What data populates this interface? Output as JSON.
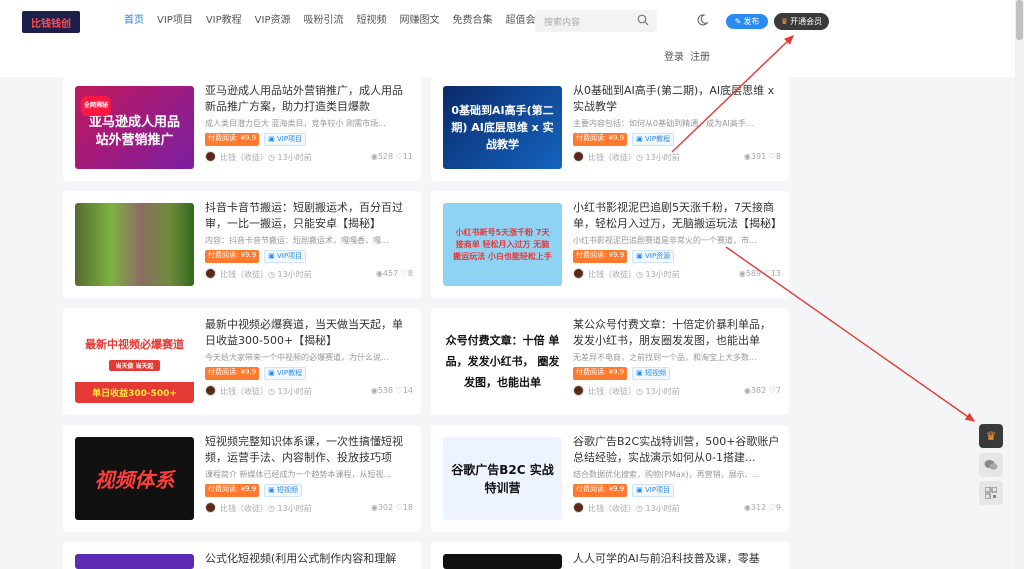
{
  "header": {
    "logo_text": "比钱钱创",
    "nav": [
      "首页",
      "VIP项目",
      "VIP教程",
      "VIP资源",
      "吸粉引流",
      "短视频",
      "网赚图文",
      "免费合集",
      "超值会员"
    ],
    "search_placeholder": "搜索内容",
    "publish_label": "发布",
    "vip_label": "开通会员",
    "login": "登录",
    "register": "注册"
  },
  "posts": [
    {
      "title": "亚马逊成人用品站外营销推广，成人用品新品推广方案，助力打造类目爆款",
      "desc": "成人类目潜力巨大 蓝海类目，竞争较小 刚需市场...",
      "price": "付费阅读: ¥9.9",
      "category": "VIP项目",
      "author": "比钱（收徒）",
      "time": "13小时前",
      "views": "528",
      "likes": "11",
      "thumb_badge": "全网揭秘",
      "thumb_text": "亚马逊成人用品站外营销推广"
    },
    {
      "title": "从0基础到AI高手(第二期)，AI底层思维 x 实战教学",
      "desc": "主要内容包括：如何从0基础到精通，成为AI高手...",
      "price": "付费阅读: ¥9.9",
      "category": "VIP教程",
      "author": "比钱（收徒）",
      "time": "13小时前",
      "views": "391",
      "likes": "8",
      "thumb_text": "0基础到AI高手(第二期) AI底层思维 x 实战教学"
    },
    {
      "title": "抖音卡音节搬运：短剧搬运术，百分百过审，一比一搬运，只能安卓【揭秘】",
      "desc": "内容：抖音卡音节搬运：短剧搬运术，嘎嘎香，嘎...",
      "price": "付费阅读: ¥9.9",
      "category": "VIP项目",
      "author": "比钱（收徒）",
      "time": "13小时前",
      "views": "457",
      "likes": "8",
      "thumb_text": ""
    },
    {
      "title": "小红书影视泥巴追剧5天涨千粉，7天接商单，轻松月入过万，无脑搬运玩法【揭秘】",
      "desc": "小红书影视泥巴追剧赛道是非常火的一个赛道，市...",
      "price": "付费阅读: ¥9.9",
      "category": "VIP资源",
      "author": "比钱（收徒）",
      "time": "13小时前",
      "views": "589",
      "likes": "13",
      "thumb_text": "小红书新号5天涨千粉 7天接商单 轻松月入过万 无脑搬运玩法 小白也能轻松上手"
    },
    {
      "title": "最新中视频必爆赛道，当天做当天起，单日收益300-500+【揭秘】",
      "desc": "今天给大家带来一个中视频的必爆赛道，为什么说...",
      "price": "付费阅读: ¥9.9",
      "category": "VIP教程",
      "author": "比钱（收徒）",
      "time": "13小时前",
      "views": "538",
      "likes": "14",
      "thumb_text": "最新中视频必爆赛道",
      "thumb_sub": "当天做 当天起",
      "thumb_foot": "单日收益300-500+"
    },
    {
      "title": "某公众号付费文章：十倍定价暴利单品，发发小红书，朋友圈发发图，也能出单",
      "desc": "无差异不电商，之前找到一个品，和淘宝上大多数...",
      "price": "付费阅读: ¥9.9",
      "category": "短视频",
      "author": "比钱（收徒）",
      "time": "13小时前",
      "views": "382",
      "likes": "7",
      "thumb_text": "众号付费文章：十倍 单品，发发小红书， 圈发发图，也能出单"
    },
    {
      "title": "短视频完整知识体系课，一次性搞懂短视频，运营手法、内容制作、投放技巧项目...",
      "desc": "课程简介 新媒体已经成为一个趋势本课程，从短视...",
      "price": "付费阅读: ¥9.9",
      "category": "短视频",
      "author": "比钱（收徒）",
      "time": "13小时前",
      "views": "302",
      "likes": "18",
      "thumb_text": "视频体系"
    },
    {
      "title": "谷歌广告B2C实战特训营，500+谷歌账户总结经验，实战演示如何从0-1搭建...",
      "desc": "结合数据优化搜索，购物(PMax)，再营销，展示、...",
      "price": "付费阅读: ¥9.9",
      "category": "VIP项目",
      "author": "比钱（收徒）",
      "time": "13小时前",
      "views": "312",
      "likes": "9",
      "thumb_text": "谷歌广告B2C 实战特训营"
    },
    {
      "title": "公式化短视频(利用公式制作内容和理解",
      "desc": "",
      "price": "",
      "category": "",
      "author": "",
      "time": "",
      "views": "",
      "likes": "",
      "thumb_text": ""
    },
    {
      "title": "人人可学的AI与前沿科技普及课，零基",
      "desc": "",
      "price": "",
      "category": "",
      "author": "",
      "time": "",
      "views": "",
      "likes": "",
      "thumb_text": ""
    }
  ],
  "colors": {
    "accent": "#2a7de1",
    "price_tag": "#ff7a2e",
    "annotation_arrow": "#e53935"
  }
}
